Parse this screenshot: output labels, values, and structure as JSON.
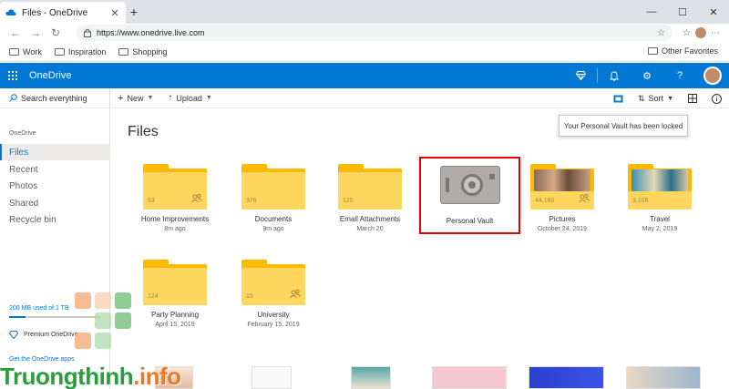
{
  "browser": {
    "tab_title": "Files - OneDrive",
    "url": "https://www.onedrive.live.com",
    "bookmarks": [
      "Work",
      "Inspiration",
      "Shopping"
    ],
    "other_favorites": "Other Favorites"
  },
  "app": {
    "brand": "OneDrive",
    "accent": "#0078d4"
  },
  "sidebar": {
    "search_placeholder": "Search everything",
    "heading": "OneDrive",
    "items": [
      {
        "label": "Files",
        "active": true
      },
      {
        "label": "Recent"
      },
      {
        "label": "Photos"
      },
      {
        "label": "Shared"
      },
      {
        "label": "Recycle bin"
      }
    ],
    "storage_text": "200 MB used of 1 TB",
    "storage_fraction": 0.18,
    "premium": "Premium OneDrive",
    "get_apps": "Get the OneDrive apps"
  },
  "commandbar": {
    "new": "New",
    "upload": "Upload",
    "sort": "Sort"
  },
  "tooltip": "Your Personal Vault has been locked",
  "page_title": "Files",
  "folders": [
    {
      "name": "Home Improvements",
      "date": "8m ago",
      "count": "53",
      "shared": true
    },
    {
      "name": "Documents",
      "date": "9m ago",
      "count": "376",
      "shared": false
    },
    {
      "name": "Email Attachments",
      "date": "March 20",
      "count": "120",
      "shared": false
    },
    {
      "name": "Personal Vault",
      "date": "",
      "count": "",
      "shared": false
    },
    {
      "name": "Pictures",
      "date": "October 24, 2019",
      "count": "44,160",
      "shared": true
    },
    {
      "name": "Travel",
      "date": "May 2, 2019",
      "count": "3,106",
      "shared": false
    },
    {
      "name": "Party Planning",
      "date": "April 15, 2019",
      "count": "124",
      "shared": false
    },
    {
      "name": "University",
      "date": "February 15, 2019",
      "count": "15",
      "shared": true
    }
  ],
  "watermark": {
    "main": "Truongthinh",
    "suffix": ".info"
  }
}
